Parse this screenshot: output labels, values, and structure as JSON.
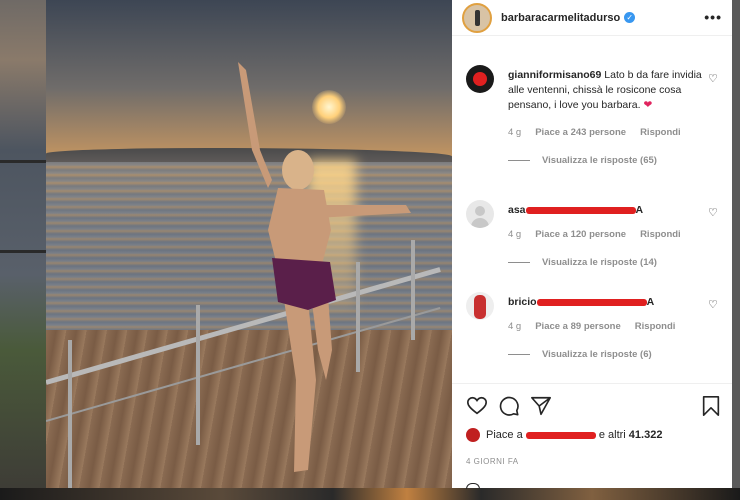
{
  "post": {
    "username": "barbaracarmelitadurso",
    "timestamp": "4 GIORNI FA",
    "likes_prefix": "Piace a",
    "likes_suffix": "e altri",
    "likes_count": "41.322"
  },
  "comments": [
    {
      "username": "gianniformisano69",
      "text": "Lato b da fare invidia alle ventenni, chissà le rosicone cosa pensano, i love you barbara.",
      "emoji": "❤",
      "age": "4 g",
      "likes": "Piace a 243 persone",
      "reply": "Rispondi",
      "view_replies": "Visualizza le risposte (65)"
    },
    {
      "username": "asa",
      "username_tail": "A",
      "text": "",
      "age": "4 g",
      "likes": "Piace a 120 persone",
      "reply": "Rispondi",
      "view_replies": "Visualizza le risposte (14)"
    },
    {
      "username": "bricio",
      "username_tail": "A",
      "text": "",
      "age": "4 g",
      "likes": "Piace a 89 persone",
      "reply": "Rispondi",
      "view_replies": "Visualizza le risposte (6)"
    }
  ],
  "icons": {
    "more": "more-options-icon",
    "verified": "verified-badge-icon",
    "like": "heart-icon",
    "comment": "comment-icon",
    "share": "share-icon",
    "save": "bookmark-icon",
    "next": "chevron-right-icon"
  },
  "colors": {
    "verified": "#3897f0",
    "redaction": "#e02020",
    "meta_text": "#8e8e8e",
    "text": "#262626"
  }
}
